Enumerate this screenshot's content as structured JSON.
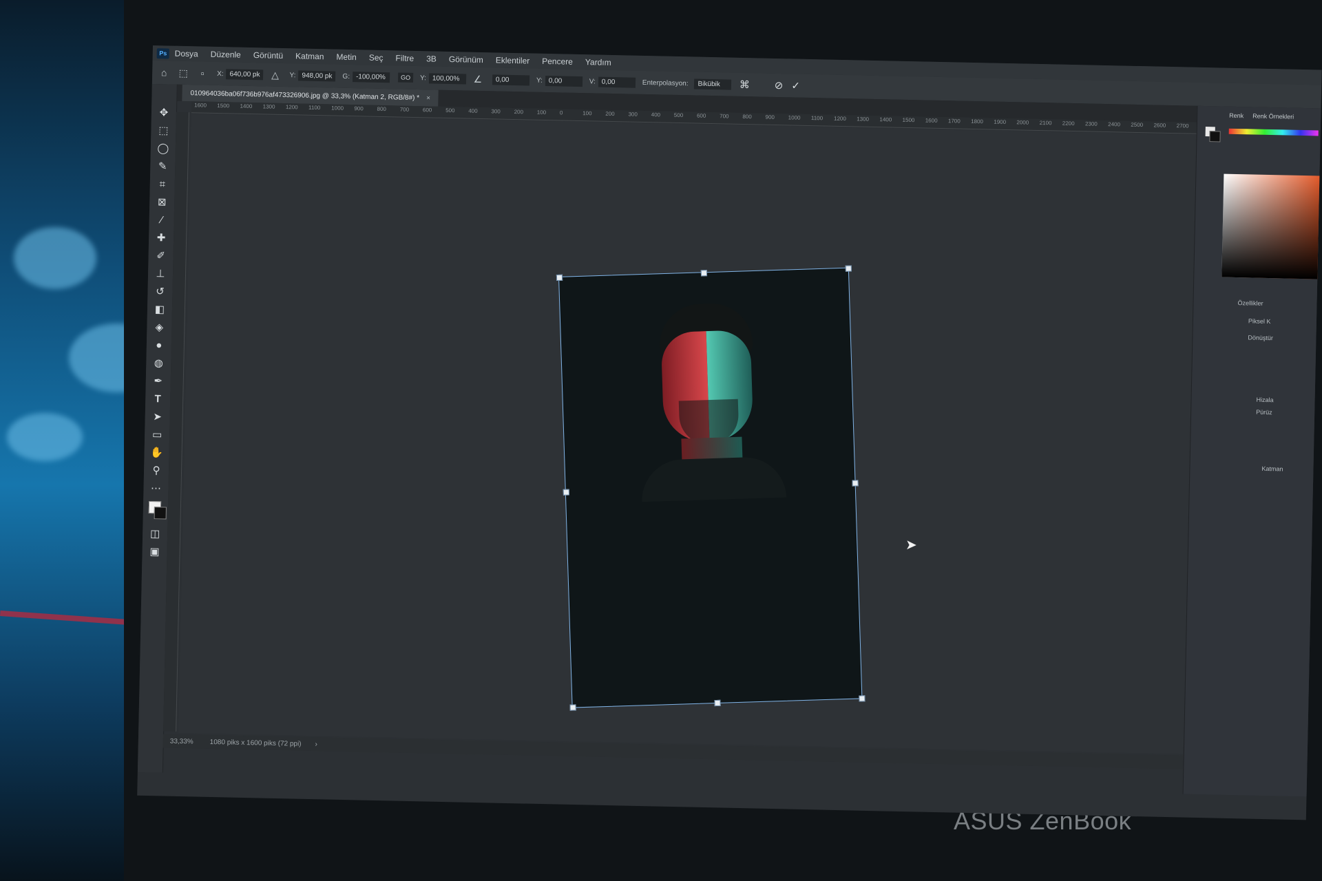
{
  "app": {
    "logo": "Ps"
  },
  "menu": [
    "Dosya",
    "Düzenle",
    "Görüntü",
    "Katman",
    "Metin",
    "Seç",
    "Filtre",
    "3B",
    "Görünüm",
    "Eklentiler",
    "Pencere",
    "Yardım"
  ],
  "options": {
    "x_label": "X:",
    "x_value": "640,00 pk",
    "y_label": "Y:",
    "y_value": "948,00 pk",
    "w_label": "G:",
    "w_value": "-100,00%",
    "link_label": "GO",
    "h_label": "Y:",
    "h_value": "100,00%",
    "angle_value": "0,00",
    "hskew_label": "Y:",
    "hskew_value": "0,00",
    "vskew_label": "V:",
    "vskew_value": "0,00",
    "interp_label": "Enterpolasyon:",
    "interp_value": "Bikübik"
  },
  "document": {
    "tab_title": "010964036ba06f736b976af473326906.jpg @ 33,3% (Katman 2, RGB/8#) *",
    "close_glyph": "×"
  },
  "ruler_ticks": [
    "1600",
    "1500",
    "1400",
    "1300",
    "1200",
    "1100",
    "1000",
    "900",
    "800",
    "700",
    "600",
    "500",
    "400",
    "300",
    "200",
    "100",
    "0",
    "100",
    "200",
    "300",
    "400",
    "500",
    "600",
    "700",
    "800",
    "900",
    "1000",
    "1100",
    "1200",
    "1300",
    "1400",
    "1500",
    "1600",
    "1700",
    "1800",
    "1900",
    "2000",
    "2100",
    "2200",
    "2300",
    "2400",
    "2500",
    "2600",
    "2700"
  ],
  "tools": [
    "move-icon",
    "marquee-icon",
    "lasso-icon",
    "quick-select-icon",
    "crop-icon",
    "frame-icon",
    "eyedropper-icon",
    "healing-icon",
    "brush-icon",
    "stamp-icon",
    "history-brush-icon",
    "eraser-icon",
    "bucket-icon",
    "blur-icon",
    "dodge-icon",
    "pen-icon",
    "type-icon",
    "path-select-icon",
    "rectangle-icon",
    "hand-icon",
    "zoom-icon",
    "more-icon"
  ],
  "right_panel": {
    "tab1": "Renk",
    "tab2": "Renk Örnekleri",
    "section1": "Özellikler",
    "item1": "Piksel K",
    "section2": "Dönüştür",
    "section3": "Hizala",
    "item2": "Pürüz",
    "section4": "Katman"
  },
  "status": {
    "zoom": "33,33%",
    "doc_size": "1080 piks x 1600 piks (72 ppi)",
    "arrow": "›"
  },
  "device_brand": "ASUS ZenBook",
  "colors": {
    "accent": "#7fb3e6",
    "panel": "#30343a",
    "canvas": "#2e3236"
  }
}
